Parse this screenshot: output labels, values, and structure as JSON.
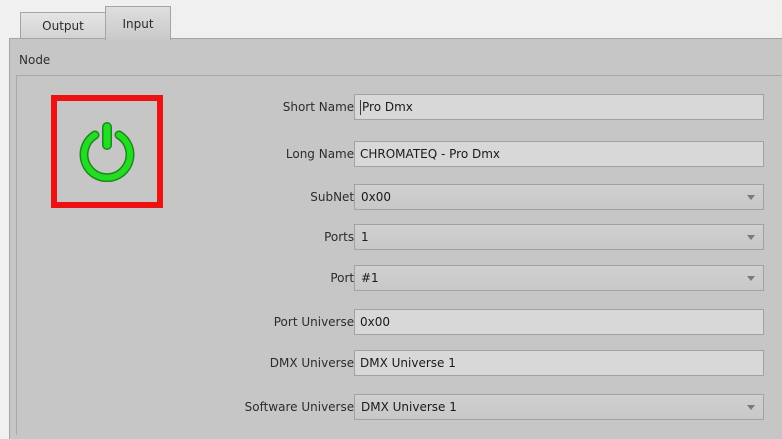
{
  "tabs": [
    {
      "label": "Output"
    },
    {
      "label": "Input"
    }
  ],
  "node": {
    "group_title": "Node",
    "power_color": "#22dd22",
    "frame_color": "#ee1111",
    "fields": {
      "short_name": {
        "label": "Short Name :",
        "value": "Pro Dmx"
      },
      "long_name": {
        "label": "Long Name :",
        "value": "CHROMATEQ - Pro Dmx"
      },
      "subnet": {
        "label": "SubNet :",
        "value": "0x00"
      },
      "ports": {
        "label": "Ports :",
        "value": "1"
      },
      "port": {
        "label": "Port :",
        "value": "#1"
      },
      "port_universe": {
        "label": "Port Universe :",
        "value": "0x00"
      },
      "dmx_universe": {
        "label": "DMX Universe :",
        "value": "DMX Universe 1"
      },
      "software_universe": {
        "label": "Software Universe :",
        "value": "DMX Universe 1"
      }
    }
  }
}
